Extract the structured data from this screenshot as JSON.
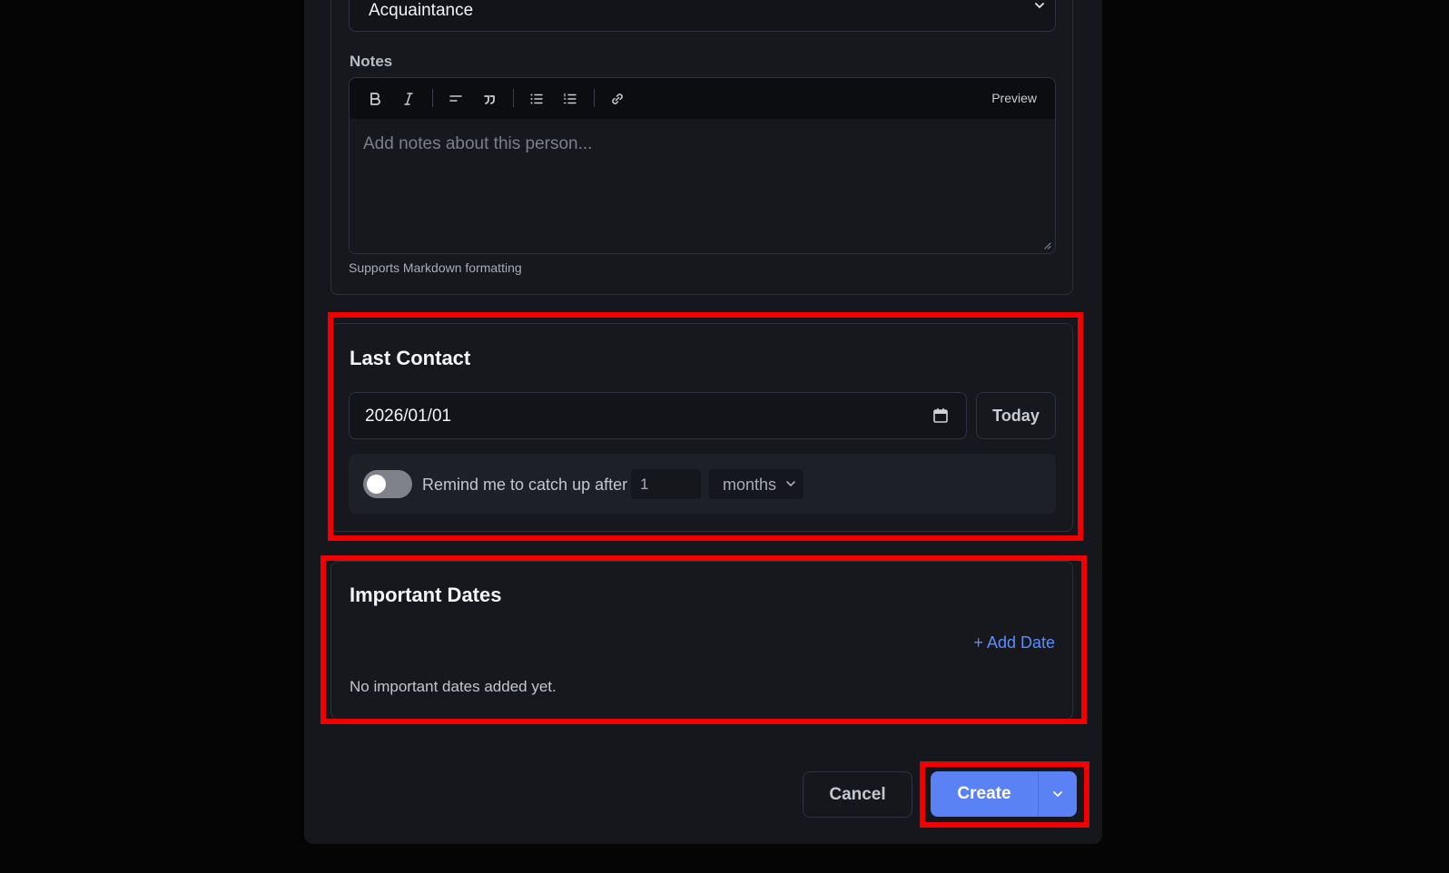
{
  "relationship": {
    "selected": "Acquaintance"
  },
  "notes": {
    "label": "Notes",
    "placeholder": "Add notes about this person...",
    "preview_label": "Preview",
    "hint": "Supports Markdown formatting",
    "toolbar_icons": [
      "bold-icon",
      "italic-icon",
      "heading-icon",
      "quote-icon",
      "bulleted-list-icon",
      "numbered-list-icon",
      "link-icon"
    ]
  },
  "last_contact": {
    "title": "Last Contact",
    "date_value": "2026/01/01",
    "today_label": "Today",
    "reminder": {
      "enabled": false,
      "label": "Remind me to catch up after",
      "number": "1",
      "unit": "months"
    }
  },
  "important_dates": {
    "title": "Important Dates",
    "add_label": "+ Add Date",
    "empty_text": "No important dates added yet."
  },
  "actions": {
    "cancel_label": "Cancel",
    "create_label": "Create"
  },
  "colors": {
    "accent": "#5b82f5",
    "link": "#5b8dff",
    "highlight": "#f00000",
    "background": "#050506",
    "panel": "#15171c"
  }
}
